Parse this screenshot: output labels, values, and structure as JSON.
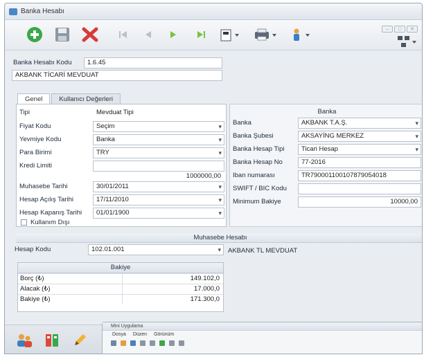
{
  "window": {
    "title": "Banka Hesabı"
  },
  "toolbar": {
    "buttons": [
      "add-icon",
      "save-icon",
      "delete-icon",
      "first-record-icon",
      "previous-record-icon",
      "next-record-icon",
      "last-record-icon",
      "template-icon",
      "print-icon",
      "user-icon",
      "network-icon"
    ],
    "colors": {
      "add": "#3aa84a",
      "delete": "#d83a3a",
      "nav_gray": "#b9c0c8",
      "nav_green": "#78c23c"
    }
  },
  "account": {
    "code_label": "Banka Hesabı Kodu",
    "code_value": "1.6.45",
    "name_value": "AKBANK TİCARİ MEVDUAT"
  },
  "tabs": [
    {
      "label": "Genel"
    },
    {
      "label": "Kullanıcı Değerleri"
    }
  ],
  "general": {
    "fields": [
      {
        "label": "Tipi",
        "value": "Mevduat Tipi",
        "dropdown": false
      },
      {
        "label": "Fiyat Kodu",
        "value": "Seçim",
        "dropdown": true
      },
      {
        "label": "Yevmiye Kodu",
        "value": "Banka",
        "dropdown": true
      },
      {
        "label": "Para Birimi",
        "value": "TRY",
        "dropdown": true
      },
      {
        "label": "Kredi Limiti",
        "value": "",
        "dropdown": false
      },
      {
        "label": "Muhasebe Tarihi",
        "value": "30/01/2011",
        "dropdown": true
      },
      {
        "label": "Hesap Açılış Tarihi",
        "value": "17/11/2010",
        "dropdown": true
      },
      {
        "label": "Hesap Kapanış Tarihi",
        "value": "01/01/1900",
        "dropdown": true
      }
    ],
    "credit_limit_amount": "1000000,00",
    "checkbox_label": "Kullanım Dışı"
  },
  "bank": {
    "title": "Banka",
    "fields": [
      {
        "label": "Banka",
        "value": "AKBANK T.A.Ş.",
        "dropdown": true
      },
      {
        "label": "Banka Şubesi",
        "value": "AKSAYİNG MERKEZ",
        "dropdown": true
      },
      {
        "label": "Banka Hesap Tipi",
        "value": "Ticari Hesap",
        "dropdown": true
      },
      {
        "label": "Banka Hesap No",
        "value": "77-2016",
        "dropdown": false
      },
      {
        "label": "Iban numarası",
        "value": "TR790001100107879054018",
        "dropdown": false
      },
      {
        "label": "SWIFT / BIC Kodu",
        "value": "",
        "dropdown": false
      },
      {
        "label": "Minimum Bakiye",
        "value": "10000,00",
        "dropdown": false,
        "right": true
      }
    ]
  },
  "accounting": {
    "title": "Muhasebe Hesabı",
    "label": "Hesap Kodu",
    "code": "102.01.001",
    "description": "AKBANK TL MEVDUAT"
  },
  "balance": {
    "title": "Bakiye",
    "rows": [
      {
        "label": "Borç (₺)",
        "value": "149.102,0"
      },
      {
        "label": "Alacak (₺)",
        "value": "17.000,0"
      },
      {
        "label": "Bakiye (₺)",
        "value": "171.300,0"
      }
    ]
  },
  "bottom": {
    "icons": [
      "users-icon",
      "documents-icon",
      "pencil-icon"
    ]
  },
  "mini_window": {
    "title": "Mini Uygulama",
    "menu": [
      "Dosya",
      "Düzen",
      "Görünüm"
    ]
  }
}
